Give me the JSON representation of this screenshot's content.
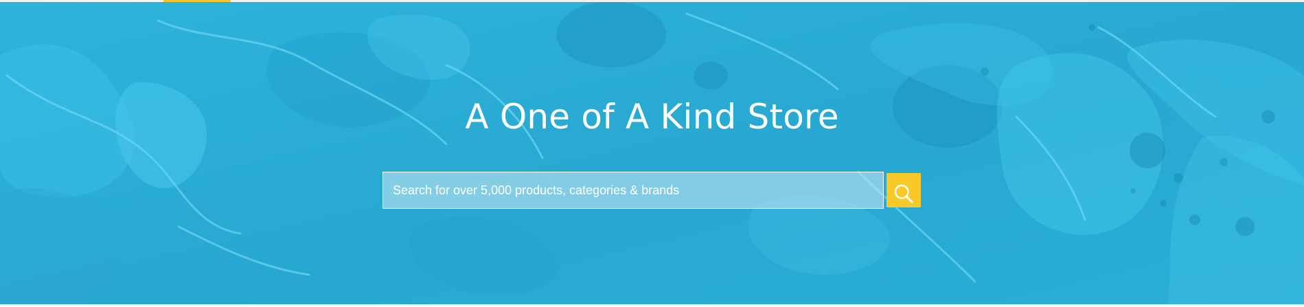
{
  "hero": {
    "title": "A One of A Kind Store",
    "background_color": "#29aed6"
  },
  "search": {
    "placeholder": "Search for over 5,000 products, categories & brands",
    "button_icon": "search-icon",
    "button_color": "#f9c928"
  },
  "header": {
    "accent_color": "#f7c528"
  }
}
